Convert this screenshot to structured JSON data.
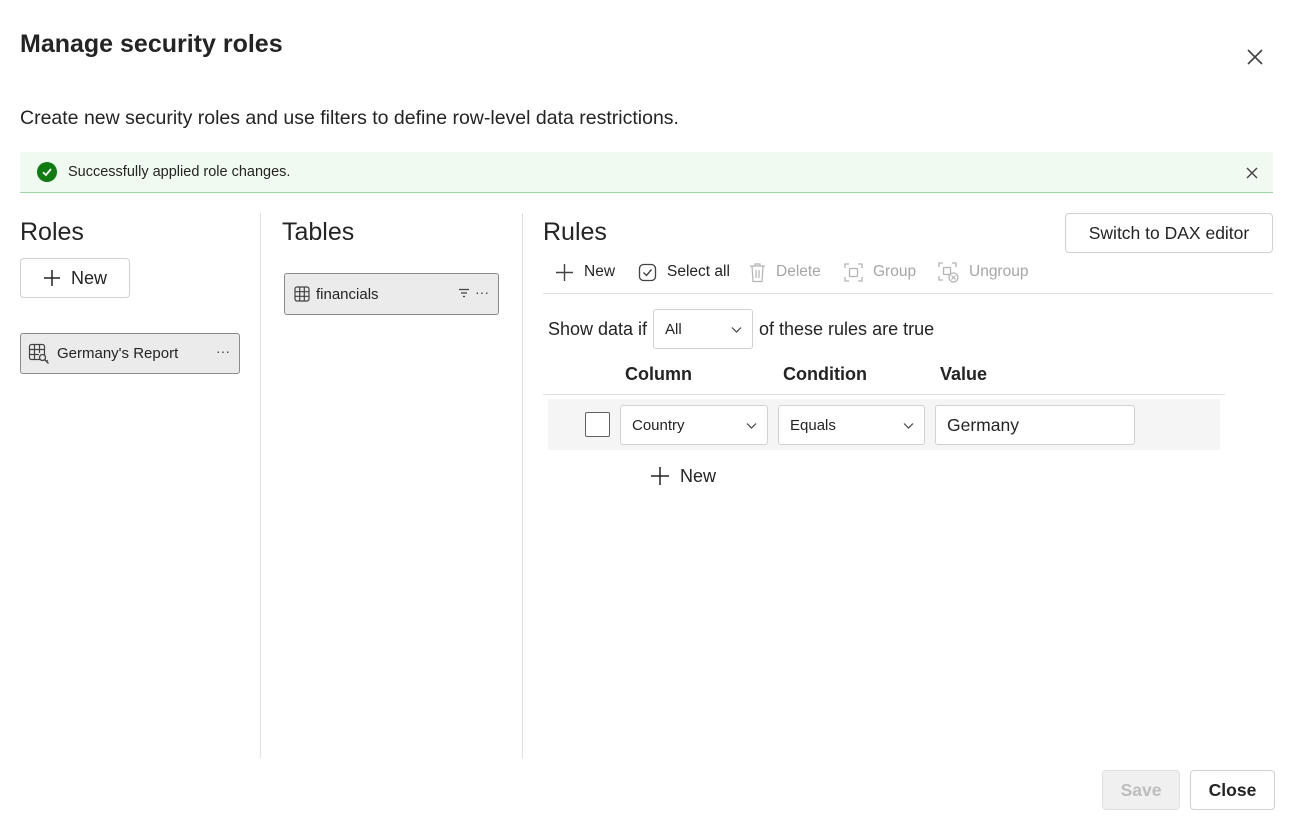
{
  "dialog": {
    "title": "Manage security roles",
    "subtitle": "Create new security roles and use filters to define row-level data restrictions.",
    "close_icon": "close-icon"
  },
  "banner": {
    "message": "Successfully applied role changes.",
    "status": "success",
    "status_color": "#107c10",
    "background_color": "#f1faf1"
  },
  "roles": {
    "heading": "Roles",
    "new_label": "New",
    "items": [
      {
        "label": "Germany's Report",
        "more": "···",
        "icon": "role-table-key-icon"
      }
    ]
  },
  "tables": {
    "heading": "Tables",
    "items": [
      {
        "label": "financials",
        "more": "···",
        "icon": "table-icon",
        "filter_icon": "filter-icon"
      }
    ]
  },
  "rules": {
    "heading": "Rules",
    "switch_label": "Switch to DAX editor",
    "toolbar": {
      "new_label": "New",
      "select_all_label": "Select all",
      "delete_label": "Delete",
      "group_label": "Group",
      "ungroup_label": "Ungroup"
    },
    "show_data_prefix": "Show data if",
    "match_mode": "All",
    "show_data_suffix": "of these rules are true",
    "columns": {
      "column": "Column",
      "condition": "Condition",
      "value": "Value"
    },
    "rows": [
      {
        "column": "Country",
        "condition": "Equals",
        "value": "Germany",
        "checked": false
      }
    ],
    "new_rule_label": "New"
  },
  "footer": {
    "save_label": "Save",
    "close_label": "Close",
    "save_enabled": false
  }
}
